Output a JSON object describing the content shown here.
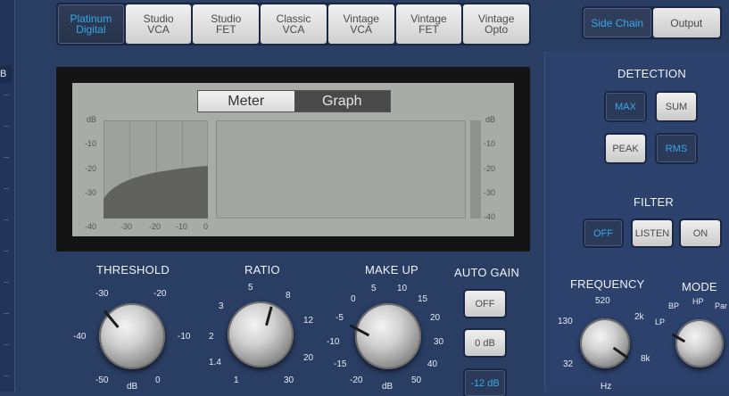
{
  "left": {
    "tag": "B"
  },
  "models": [
    {
      "label": "Platinum\nDigital",
      "active": true
    },
    {
      "label": "Studio\nVCA",
      "active": false
    },
    {
      "label": "Studio\nFET",
      "active": false
    },
    {
      "label": "Classic\nVCA",
      "active": false
    },
    {
      "label": "Vintage\nVCA",
      "active": false
    },
    {
      "label": "Vintage\nFET",
      "active": false
    },
    {
      "label": "Vintage\nOpto",
      "active": false
    }
  ],
  "sidechain": {
    "side_chain": "Side Chain",
    "output": "Output",
    "selected": "Side Chain"
  },
  "display": {
    "meter_tab": "Meter",
    "graph_tab": "Graph",
    "selected": "Graph",
    "left_scale": [
      "dB",
      "-10",
      "-20",
      "-30",
      "-40"
    ],
    "right_scale": [
      "dB",
      "-10",
      "-20",
      "-30",
      "-40"
    ],
    "bottom_scale": [
      "-30",
      "-20",
      "-10",
      "0"
    ]
  },
  "threshold": {
    "title": "THRESHOLD",
    "scale": [
      "-30",
      "-20",
      "-40",
      "-10",
      "-50",
      "0"
    ],
    "unit": "dB"
  },
  "ratio": {
    "title": "RATIO",
    "scale": [
      "5",
      "3",
      "8",
      "2",
      "12",
      "1.4",
      "20",
      "1",
      "30"
    ]
  },
  "makeup": {
    "title": "MAKE UP",
    "scale": [
      "5",
      "10",
      "0",
      "15",
      "-5",
      "20",
      "-10",
      "30",
      "-15",
      "40",
      "-20",
      "50"
    ],
    "unit": "dB"
  },
  "auto_gain": {
    "title": "AUTO GAIN",
    "off": "OFF",
    "zero": "0 dB",
    "minus12": "-12 dB",
    "selected": "-12 dB"
  },
  "detection": {
    "title": "DETECTION",
    "max": "MAX",
    "sum": "SUM",
    "peak": "PEAK",
    "rms": "RMS",
    "selected": [
      "MAX",
      "RMS"
    ]
  },
  "filter": {
    "title": "FILTER",
    "off": "OFF",
    "listen": "LISTEN",
    "on": "ON",
    "selected": "OFF"
  },
  "frequency": {
    "title": "FREQUENCY",
    "scale": [
      "520",
      "130",
      "2k",
      "32",
      "8k"
    ],
    "unit": "Hz"
  },
  "mode": {
    "title": "MODE",
    "scale": [
      "BP",
      "HP",
      "LP",
      "Par"
    ]
  },
  "colors": {
    "accent": "#36a8ea",
    "panel": "#2a3d63"
  }
}
